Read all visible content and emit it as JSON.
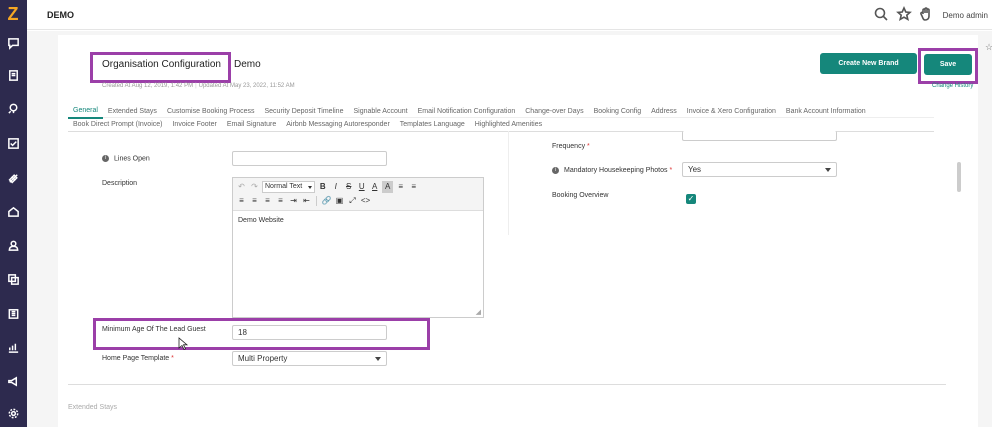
{
  "app": {
    "brand": "DEMO",
    "user": "Demo admin",
    "logo": "Z"
  },
  "icons": {
    "sidebar": [
      "chat-icon",
      "book-icon",
      "rocket-icon",
      "checklist-icon",
      "tag-icon",
      "home-icon",
      "user-icon",
      "copy-icon",
      "calendar-icon",
      "chart-icon",
      "megaphone-icon",
      "gear-icon"
    ],
    "topbar": [
      "search-icon",
      "star-icon",
      "hand-icon"
    ]
  },
  "header": {
    "title": "Organisation Configuration",
    "org_name": "Demo",
    "created": "Created At Aug 12, 2019, 1:42 PM",
    "updated": "Updated At May 23, 2022, 11:52 AM",
    "create_brand_label": "Create New Brand",
    "save_label": "Save",
    "change_history_label": "Change History",
    "star_glyph": "☆",
    "pin_glyph": "⚲"
  },
  "tabs_row1": [
    "General",
    "Extended Stays",
    "Customise Booking Process",
    "Security Deposit Timeline",
    "Signable Account",
    "Email Notification Configuration",
    "Change-over Days",
    "Booking Config",
    "Address",
    "Invoice & Xero Configuration",
    "Bank Account Information"
  ],
  "tabs_row2": [
    "Book Direct Prompt (Invoice)",
    "Invoice Footer",
    "Email Signature",
    "Airbnb Messaging Autoresponder",
    "Templates Language",
    "Highlighted Amenities"
  ],
  "active_tab": "General",
  "form": {
    "lines_open_label": "Lines Open",
    "lines_open_value": "",
    "description_label": "Description",
    "editor_format": "Normal Text",
    "editor_content": "Demo Website",
    "min_age_label": "Minimum Age Of The Lead Guest",
    "min_age_value": "18",
    "home_template_label": "Home Page Template",
    "home_template_value": "Multi Property",
    "frequency_label": "Frequency",
    "mandatory_label": "Mandatory Housekeeping Photos",
    "mandatory_value": "Yes",
    "booking_overview_label": "Booking Overview",
    "booking_overview_checked": true,
    "required_mark": "*",
    "info_glyph": "i",
    "check_glyph": "✓",
    "resize_glyph": "◢"
  },
  "toolbar": {
    "undo": "↶",
    "redo": "↷",
    "bold": "B",
    "italic": "I",
    "strike": "S",
    "underline": "U",
    "font_color": "A",
    "bg_color": "A",
    "bullet_list": "≡",
    "numbered_list": "≡",
    "align_left": "≡",
    "align_center": "≡",
    "align_right": "≡",
    "justify": "≡",
    "indent": "⇥",
    "outdent": "⇤",
    "link": "🔗",
    "image": "▣",
    "fullscreen": "⤢",
    "source": "<>"
  },
  "sections": {
    "next_title": "Extended Stays"
  },
  "colors": {
    "accent": "#15877b",
    "sidebar": "#2d2a4e",
    "highlight": "#9b3fa8"
  }
}
